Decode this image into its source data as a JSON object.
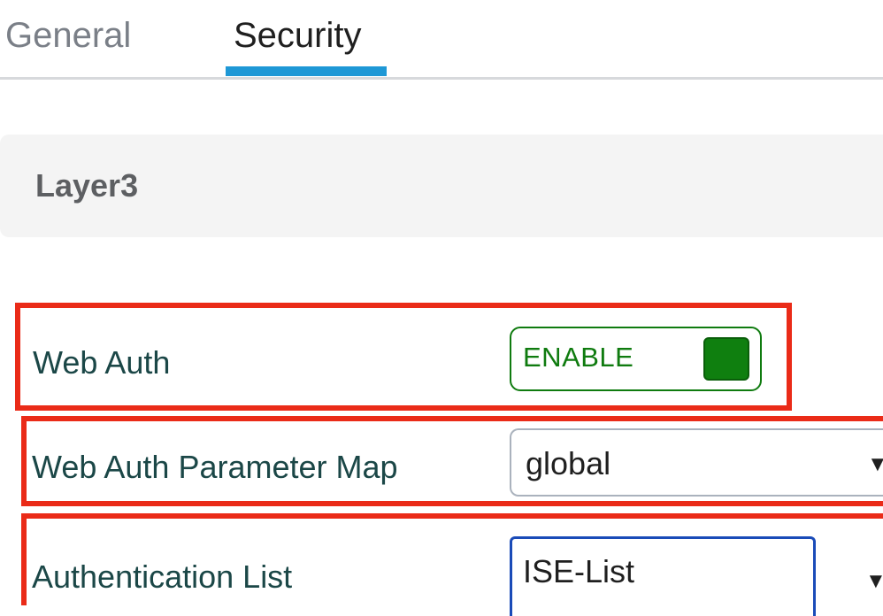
{
  "tabs": [
    {
      "label": "General",
      "active": false
    },
    {
      "label": "Security",
      "active": true
    }
  ],
  "section": {
    "title": "Layer3"
  },
  "web_auth": {
    "label": "Web Auth",
    "toggle_label": "ENABLE",
    "enabled": true
  },
  "web_auth_parameter_map": {
    "label": "Web Auth Parameter Map",
    "value": "global",
    "arrow": "▼"
  },
  "authentication_list": {
    "label": "Authentication List",
    "value": "ISE-List",
    "arrow": "▼"
  },
  "colors": {
    "active_tab_indicator": "#1e98d6",
    "highlight_box": "#ea2b18",
    "toggle_enabled": "#0f7b0f",
    "focus_border": "#1a4bb8",
    "label_text": "#1b4747"
  },
  "icons": {
    "dropdown": "chevron-down-icon",
    "toggle_knob": "toggle-knob"
  }
}
